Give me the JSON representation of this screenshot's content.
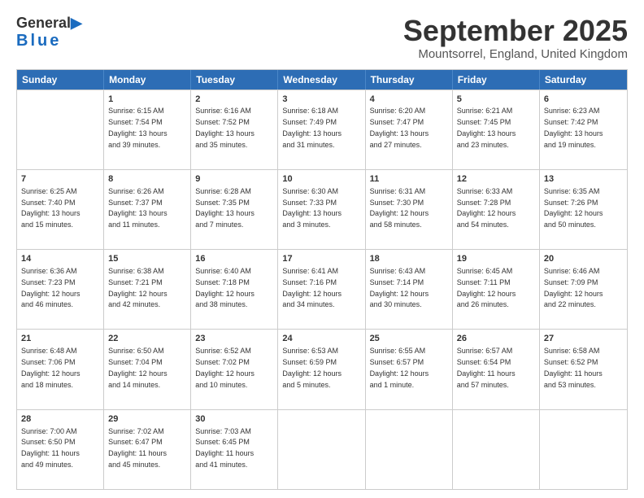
{
  "header": {
    "logo": {
      "general": "General",
      "blue": "Blue"
    },
    "title": "September 2025",
    "location": "Mountsorrel, England, United Kingdom"
  },
  "calendar": {
    "days": [
      "Sunday",
      "Monday",
      "Tuesday",
      "Wednesday",
      "Thursday",
      "Friday",
      "Saturday"
    ],
    "weeks": [
      [
        {
          "day": "",
          "info": ""
        },
        {
          "day": "1",
          "info": "Sunrise: 6:15 AM\nSunset: 7:54 PM\nDaylight: 13 hours\nand 39 minutes."
        },
        {
          "day": "2",
          "info": "Sunrise: 6:16 AM\nSunset: 7:52 PM\nDaylight: 13 hours\nand 35 minutes."
        },
        {
          "day": "3",
          "info": "Sunrise: 6:18 AM\nSunset: 7:49 PM\nDaylight: 13 hours\nand 31 minutes."
        },
        {
          "day": "4",
          "info": "Sunrise: 6:20 AM\nSunset: 7:47 PM\nDaylight: 13 hours\nand 27 minutes."
        },
        {
          "day": "5",
          "info": "Sunrise: 6:21 AM\nSunset: 7:45 PM\nDaylight: 13 hours\nand 23 minutes."
        },
        {
          "day": "6",
          "info": "Sunrise: 6:23 AM\nSunset: 7:42 PM\nDaylight: 13 hours\nand 19 minutes."
        }
      ],
      [
        {
          "day": "7",
          "info": "Sunrise: 6:25 AM\nSunset: 7:40 PM\nDaylight: 13 hours\nand 15 minutes."
        },
        {
          "day": "8",
          "info": "Sunrise: 6:26 AM\nSunset: 7:37 PM\nDaylight: 13 hours\nand 11 minutes."
        },
        {
          "day": "9",
          "info": "Sunrise: 6:28 AM\nSunset: 7:35 PM\nDaylight: 13 hours\nand 7 minutes."
        },
        {
          "day": "10",
          "info": "Sunrise: 6:30 AM\nSunset: 7:33 PM\nDaylight: 13 hours\nand 3 minutes."
        },
        {
          "day": "11",
          "info": "Sunrise: 6:31 AM\nSunset: 7:30 PM\nDaylight: 12 hours\nand 58 minutes."
        },
        {
          "day": "12",
          "info": "Sunrise: 6:33 AM\nSunset: 7:28 PM\nDaylight: 12 hours\nand 54 minutes."
        },
        {
          "day": "13",
          "info": "Sunrise: 6:35 AM\nSunset: 7:26 PM\nDaylight: 12 hours\nand 50 minutes."
        }
      ],
      [
        {
          "day": "14",
          "info": "Sunrise: 6:36 AM\nSunset: 7:23 PM\nDaylight: 12 hours\nand 46 minutes."
        },
        {
          "day": "15",
          "info": "Sunrise: 6:38 AM\nSunset: 7:21 PM\nDaylight: 12 hours\nand 42 minutes."
        },
        {
          "day": "16",
          "info": "Sunrise: 6:40 AM\nSunset: 7:18 PM\nDaylight: 12 hours\nand 38 minutes."
        },
        {
          "day": "17",
          "info": "Sunrise: 6:41 AM\nSunset: 7:16 PM\nDaylight: 12 hours\nand 34 minutes."
        },
        {
          "day": "18",
          "info": "Sunrise: 6:43 AM\nSunset: 7:14 PM\nDaylight: 12 hours\nand 30 minutes."
        },
        {
          "day": "19",
          "info": "Sunrise: 6:45 AM\nSunset: 7:11 PM\nDaylight: 12 hours\nand 26 minutes."
        },
        {
          "day": "20",
          "info": "Sunrise: 6:46 AM\nSunset: 7:09 PM\nDaylight: 12 hours\nand 22 minutes."
        }
      ],
      [
        {
          "day": "21",
          "info": "Sunrise: 6:48 AM\nSunset: 7:06 PM\nDaylight: 12 hours\nand 18 minutes."
        },
        {
          "day": "22",
          "info": "Sunrise: 6:50 AM\nSunset: 7:04 PM\nDaylight: 12 hours\nand 14 minutes."
        },
        {
          "day": "23",
          "info": "Sunrise: 6:52 AM\nSunset: 7:02 PM\nDaylight: 12 hours\nand 10 minutes."
        },
        {
          "day": "24",
          "info": "Sunrise: 6:53 AM\nSunset: 6:59 PM\nDaylight: 12 hours\nand 5 minutes."
        },
        {
          "day": "25",
          "info": "Sunrise: 6:55 AM\nSunset: 6:57 PM\nDaylight: 12 hours\nand 1 minute."
        },
        {
          "day": "26",
          "info": "Sunrise: 6:57 AM\nSunset: 6:54 PM\nDaylight: 11 hours\nand 57 minutes."
        },
        {
          "day": "27",
          "info": "Sunrise: 6:58 AM\nSunset: 6:52 PM\nDaylight: 11 hours\nand 53 minutes."
        }
      ],
      [
        {
          "day": "28",
          "info": "Sunrise: 7:00 AM\nSunset: 6:50 PM\nDaylight: 11 hours\nand 49 minutes."
        },
        {
          "day": "29",
          "info": "Sunrise: 7:02 AM\nSunset: 6:47 PM\nDaylight: 11 hours\nand 45 minutes."
        },
        {
          "day": "30",
          "info": "Sunrise: 7:03 AM\nSunset: 6:45 PM\nDaylight: 11 hours\nand 41 minutes."
        },
        {
          "day": "",
          "info": ""
        },
        {
          "day": "",
          "info": ""
        },
        {
          "day": "",
          "info": ""
        },
        {
          "day": "",
          "info": ""
        }
      ]
    ]
  }
}
